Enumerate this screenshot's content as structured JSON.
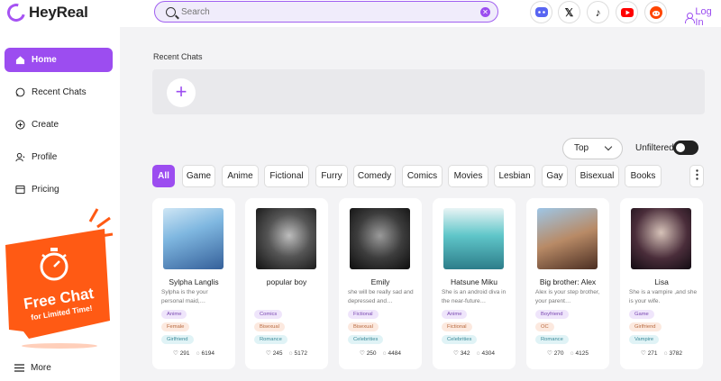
{
  "app": {
    "name": "HeyReal"
  },
  "search": {
    "placeholder": "Search"
  },
  "login": {
    "label": "Log In"
  },
  "social": [
    {
      "icon": "discord-icon",
      "glyph": "◕",
      "color": "#5865f2"
    },
    {
      "icon": "x-icon",
      "glyph": "X",
      "color": "#222222"
    },
    {
      "icon": "tiktok-icon",
      "glyph": "♪",
      "color": "#111111"
    },
    {
      "icon": "youtube-icon",
      "glyph": "▶",
      "color": "#ff0000"
    },
    {
      "icon": "reddit-icon",
      "glyph": "●",
      "color": "#ff4500"
    }
  ],
  "sidebar": {
    "items": [
      {
        "label": "Home",
        "icon": "home-icon"
      },
      {
        "label": "Recent Chats",
        "icon": "chat-icon"
      },
      {
        "label": "Create",
        "icon": "plus-circle-icon"
      },
      {
        "label": "Profile",
        "icon": "profile-icon"
      },
      {
        "label": "Pricing",
        "icon": "pricing-icon"
      }
    ],
    "promo": {
      "line1": "Free Chat",
      "line2": "for Limited Time!"
    },
    "more_label": "More"
  },
  "main": {
    "recent_title": "Recent Chats",
    "sort": {
      "selected": "Top"
    },
    "unfiltered_label": "Unfiltered",
    "filters": [
      "All",
      "Game",
      "Anime",
      "Fictional",
      "Furry",
      "Comedy",
      "Comics",
      "Movies",
      "Lesbian",
      "Gay",
      "Bisexual",
      "Books"
    ],
    "more_filters_label": "⋮"
  },
  "cards": [
    {
      "name": "Sylpha Langlis",
      "desc": "Sylpha is the your personal maid,…",
      "tags": [
        "Anime",
        "Female",
        "Girlfriend"
      ],
      "likes": "291",
      "chats": "6194"
    },
    {
      "name": "popular boy",
      "desc": "",
      "tags": [
        "Comics",
        "Bisexual",
        "Romance"
      ],
      "likes": "245",
      "chats": "5172"
    },
    {
      "name": "Emily",
      "desc": "she will be really sad and depressed and…",
      "tags": [
        "Fictional",
        "Bisexual",
        "Celebrities"
      ],
      "likes": "250",
      "chats": "4484"
    },
    {
      "name": "Hatsune Miku",
      "desc": "She is an android diva in the near-future…",
      "tags": [
        "Anime",
        "Fictional",
        "Celebrities"
      ],
      "likes": "342",
      "chats": "4304"
    },
    {
      "name": "Big brother: Alex",
      "desc": "Alex is your step brother, your parent…",
      "tags": [
        "Boyfriend",
        "OC",
        "Romance"
      ],
      "likes": "270",
      "chats": "4125"
    },
    {
      "name": "Lisa",
      "desc": "She is a vampire ,and she is your wife.",
      "tags": [
        "Game",
        "Girlfriend",
        "Vampire"
      ],
      "likes": "271",
      "chats": "3782"
    }
  ],
  "colors": {
    "accent": "#9c4df0",
    "promo": "#ff5a14"
  }
}
